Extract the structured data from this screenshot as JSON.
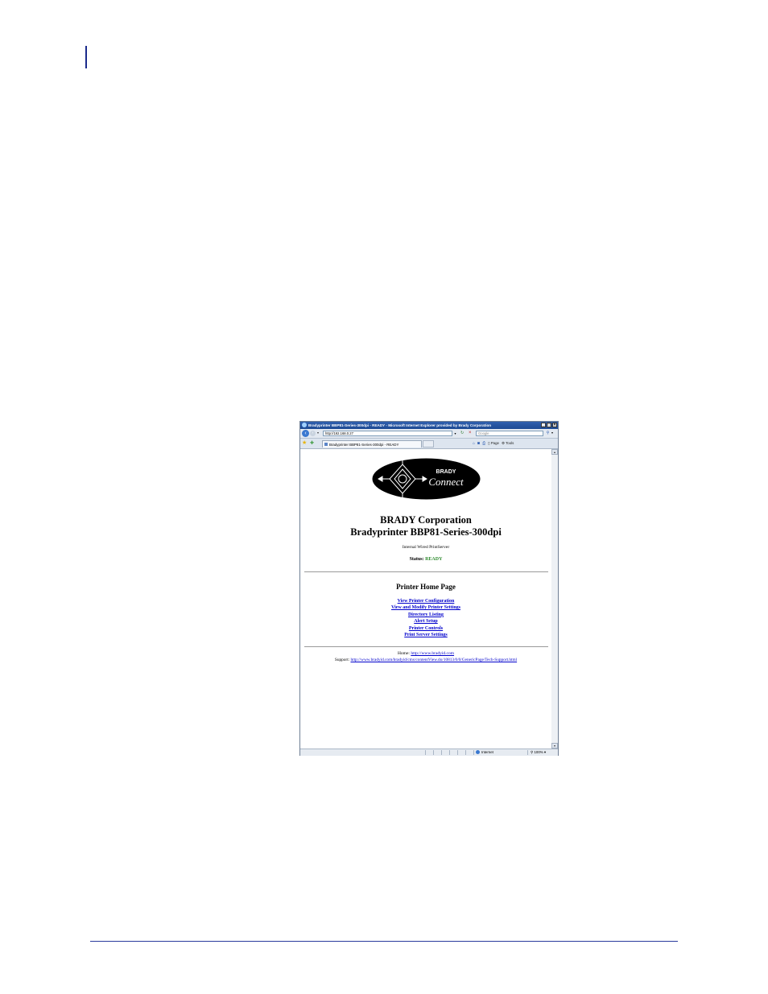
{
  "browser": {
    "window_title": "Bradyprinter BBP81-Series-300dpi - READY - Microsoft Internet Explorer provided by Brady Corporation",
    "address": "http://192.168.0.27",
    "search_placeholder": "Google",
    "tab_title": "Bradyprinter BBP81-Series-300dpi - READY",
    "commands": {
      "page": "Page",
      "tools": "Tools"
    },
    "status": {
      "zone": "Internet",
      "zoom": "100%"
    }
  },
  "page": {
    "logo": {
      "line1": "BRADY",
      "line2": "Connect"
    },
    "org": "BRADY Corporation",
    "model": "Bradyprinter BBP81-Series-300dpi",
    "server_type": "Internal Wired PrintServer",
    "status_label": "Status:",
    "status_value": "READY",
    "home_title": "Printer Home Page",
    "links": [
      "View Printer Configuration",
      "View and Modify Printer Settings",
      "Directory Listing",
      "Alert Setup",
      "Printer Controls",
      "Print Server Settings"
    ],
    "home_label": "Home:",
    "home_url": "http://www.bradyid.com",
    "support_label": "Support:",
    "support_url": "http://www.bradyid.com/bradyid/cms/contentView.do/10813/0/0/GenericPage/Tech-Support.html"
  },
  "colors": {
    "accent": "#1a2a8c",
    "link": "#0000cc",
    "ready": "#2e8b2e",
    "titlebar": "#2f5fae"
  }
}
